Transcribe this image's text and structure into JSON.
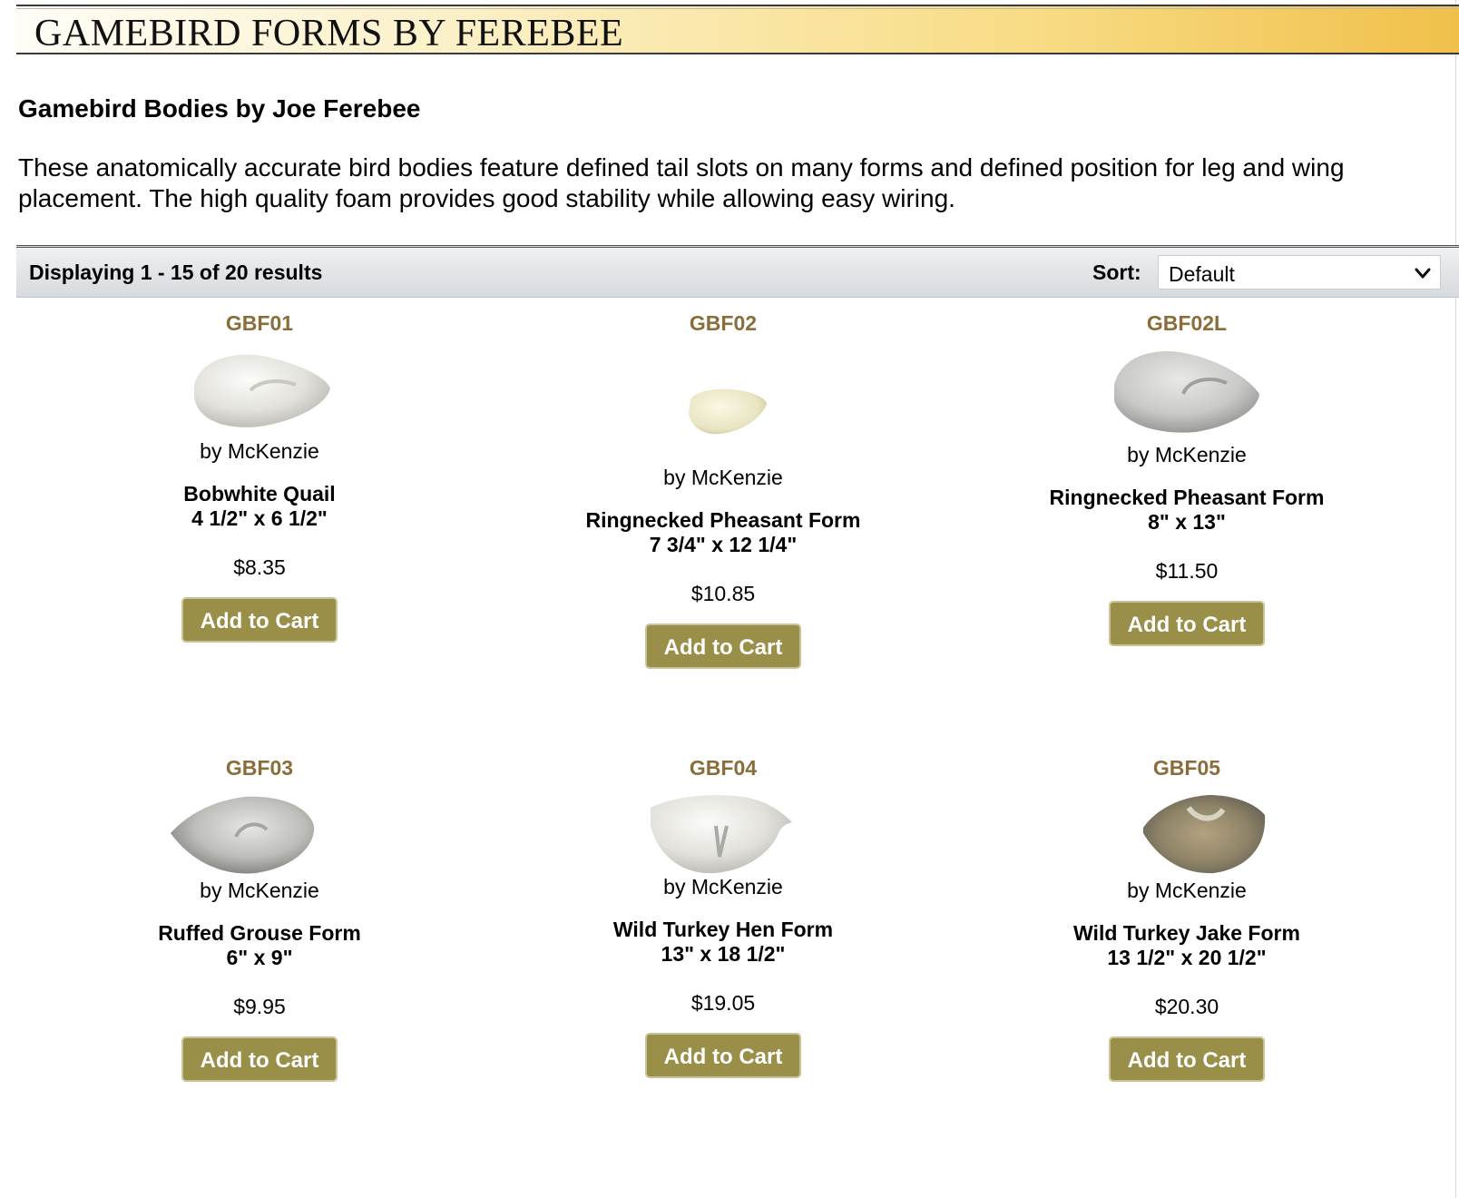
{
  "header": {
    "title": "GAMEBIRD FORMS BY FEREBEE"
  },
  "intro": {
    "subtitle": "Gamebird Bodies by Joe Ferebee",
    "description": "These anatomically accurate bird bodies feature defined tail slots on many forms and defined position for leg and wing placement. The high quality foam provides good stability while allowing easy wiring."
  },
  "toolbar": {
    "results_text": "Displaying 1 - 15 of 20 results",
    "sort_label": "Sort:",
    "sort_value": "Default"
  },
  "products": [
    {
      "sku": "GBF01",
      "brand": "by McKenzie",
      "name": "Bobwhite Quail",
      "size": "4 1/2\" x 6 1/2\"",
      "price": "$8.35",
      "button": "Add to Cart",
      "image_icon": "quail-form-image"
    },
    {
      "sku": "GBF02",
      "brand": "by McKenzie",
      "name": "Ringnecked Pheasant Form",
      "size": "7 3/4\" x 12 1/4\"",
      "price": "$10.85",
      "button": "Add to Cart",
      "image_icon": "pheasant-form-small-image"
    },
    {
      "sku": "GBF02L",
      "brand": "by McKenzie",
      "name": "Ringnecked Pheasant Form",
      "size": "8\" x 13\"",
      "price": "$11.50",
      "button": "Add to Cart",
      "image_icon": "pheasant-form-large-image"
    },
    {
      "sku": "GBF03",
      "brand": "by McKenzie",
      "name": "Ruffed Grouse Form",
      "size": "6\" x 9\"",
      "price": "$9.95",
      "button": "Add to Cart",
      "image_icon": "grouse-form-image"
    },
    {
      "sku": "GBF04",
      "brand": "by McKenzie",
      "name": "Wild Turkey Hen Form",
      "size": "13\" x 18 1/2\"",
      "price": "$19.05",
      "button": "Add to Cart",
      "image_icon": "turkey-hen-form-image"
    },
    {
      "sku": "GBF05",
      "brand": "by McKenzie",
      "name": "Wild Turkey Jake Form",
      "size": "13 1/2\" x 20 1/2\"",
      "price": "$20.30",
      "button": "Add to Cart",
      "image_icon": "turkey-jake-form-image"
    }
  ],
  "colors": {
    "sku": "#8a6d3b",
    "button": "#9a8f48",
    "banner_end": "#f0c04a"
  }
}
